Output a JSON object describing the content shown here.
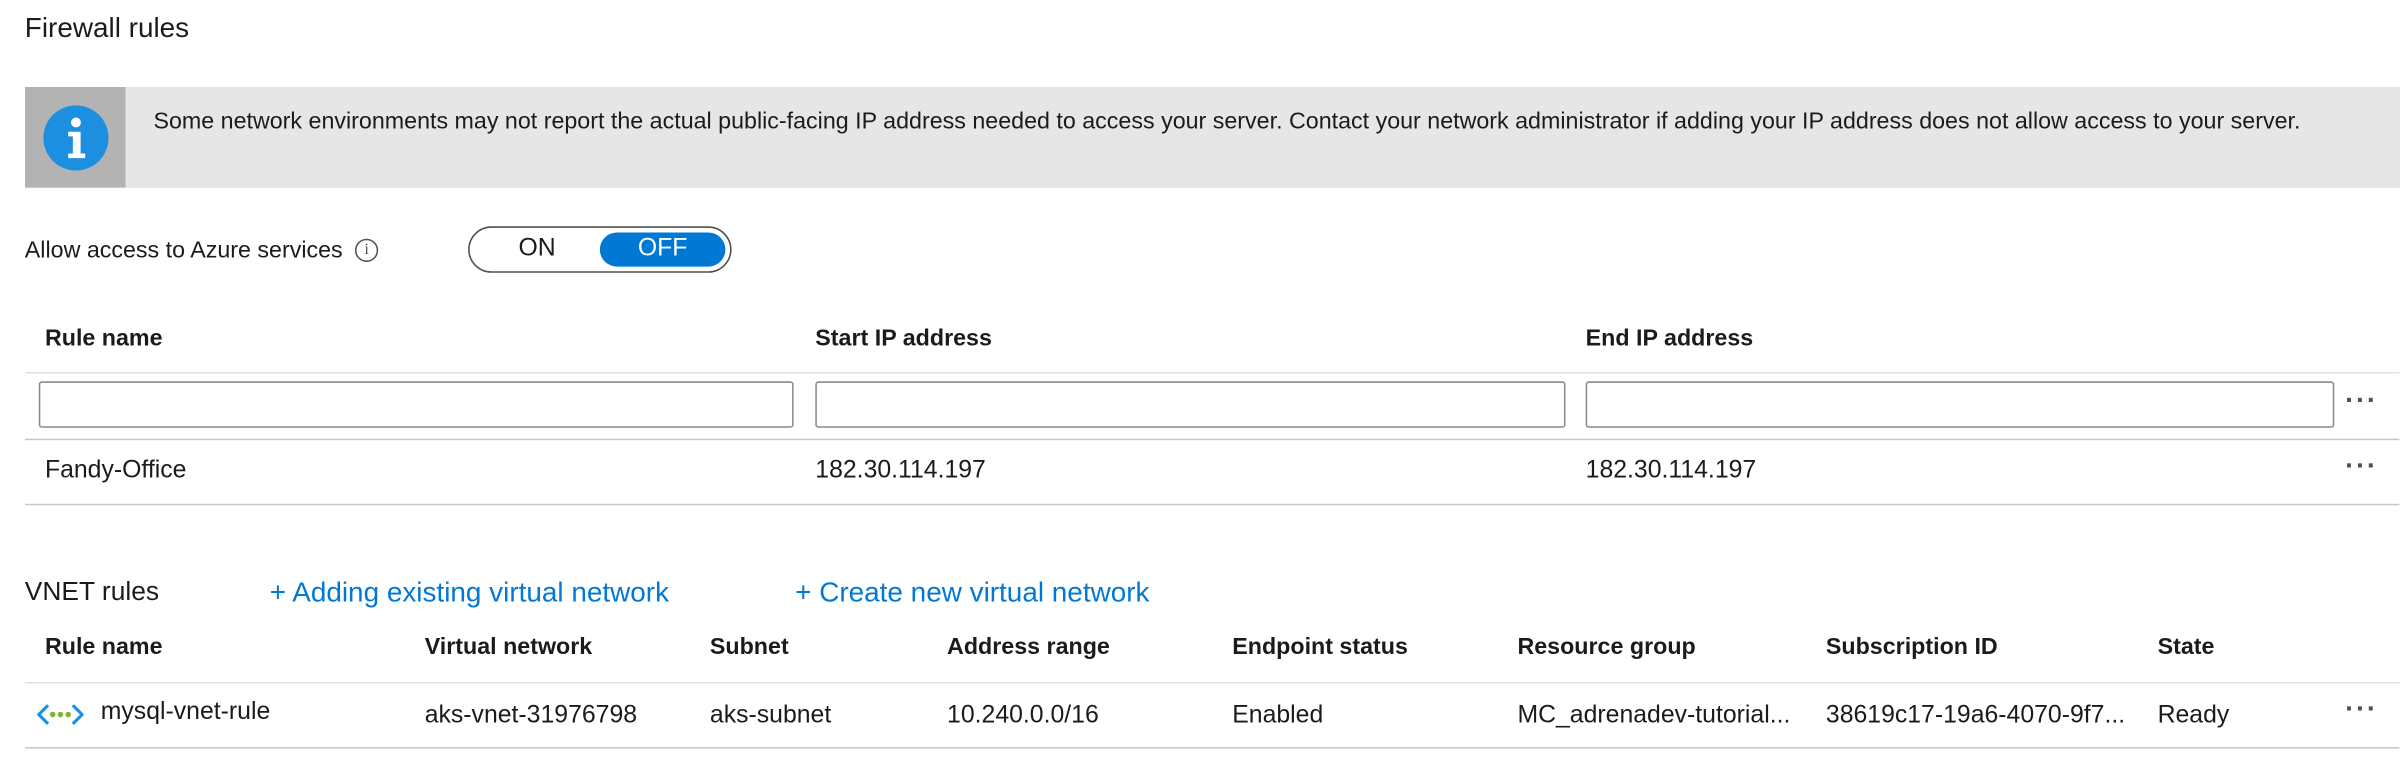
{
  "firewall": {
    "title": "Firewall rules",
    "info_message": "Some network environments may not report the actual public-facing IP address needed to access your server.  Contact your network administrator if adding your IP address does not allow access to your server.",
    "allow_azure_label": "Allow access to Azure services",
    "toggle": {
      "on_label": "ON",
      "off_label": "OFF",
      "selected": "OFF"
    },
    "columns": [
      "Rule name",
      "Start IP address",
      "End IP address"
    ],
    "new_rule": {
      "name": "",
      "start_ip": "",
      "end_ip": ""
    },
    "rules": [
      {
        "name": "Fandy-Office",
        "start_ip": "182.30.114.197",
        "end_ip": "182.30.114.197"
      }
    ],
    "more_icon": "more-ellipsis-icon"
  },
  "vnet": {
    "title": "VNET rules",
    "add_existing_link": "+ Adding existing virtual network",
    "create_new_link": "+ Create new virtual network",
    "columns": [
      "Rule name",
      "Virtual network",
      "Subnet",
      "Address range",
      "Endpoint status",
      "Resource group",
      "Subscription ID",
      "State"
    ],
    "rules": [
      {
        "icon": "virtual-network-icon",
        "name": "mysql-vnet-rule",
        "virtual_network": "aks-vnet-31976798",
        "subnet": "aks-subnet",
        "address_range": "10.240.0.0/16",
        "endpoint_status": "Enabled",
        "resource_group": "MC_adrenadev-tutorial...",
        "subscription_id": "38619c17-19a6-4070-9f7...",
        "state": "Ready"
      }
    ]
  },
  "colors": {
    "accent": "#0078d4",
    "info_bar_bg": "#e6e6e6",
    "info_icon_bg": "#b3b3b3"
  }
}
